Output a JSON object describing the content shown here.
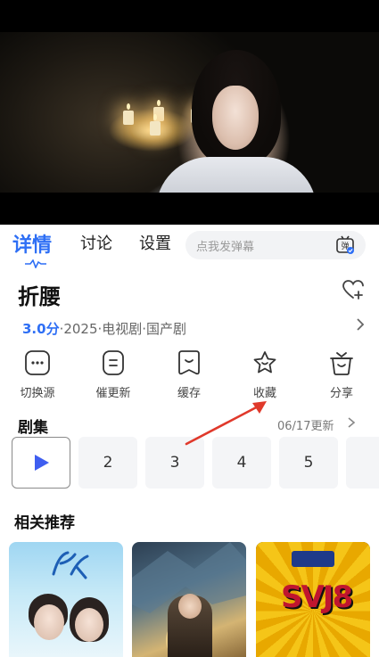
{
  "tabs": [
    {
      "label": "详情",
      "active": true
    },
    {
      "label": "讨论"
    },
    {
      "label": "设置"
    }
  ],
  "danmu": {
    "placeholder": "点我发弹幕",
    "icon": "danmu-toggle-icon",
    "icon_text": "弹"
  },
  "show": {
    "title": "折腰",
    "score": "3.0分",
    "meta": "·2025·电视剧·国产剧"
  },
  "actions": [
    {
      "label": "切换源",
      "icon": "source-icon"
    },
    {
      "label": "催更新",
      "icon": "update-icon"
    },
    {
      "label": "缓存",
      "icon": "download-icon"
    },
    {
      "label": "收藏",
      "icon": "star-icon"
    },
    {
      "label": "分享",
      "icon": "share-icon"
    }
  ],
  "episodes": {
    "heading": "剧集",
    "update": "06/17更新",
    "items": [
      "2",
      "3",
      "4",
      "5"
    ]
  },
  "recommend": {
    "heading": "相关推荐",
    "poster3_text": "SVJ8"
  },
  "colors": {
    "accent": "#2e6ff5",
    "arrow": "#e0392b"
  }
}
